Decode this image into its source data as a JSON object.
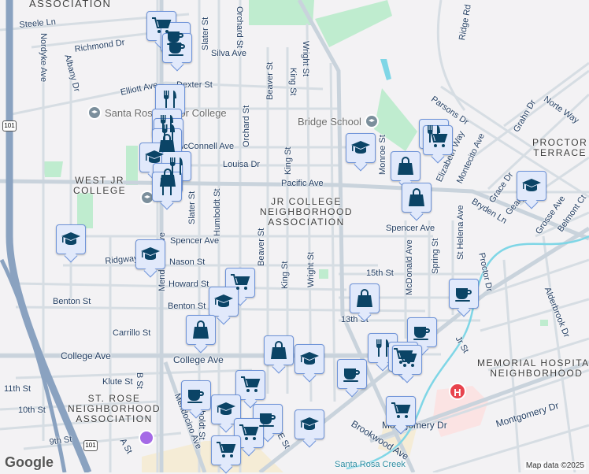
{
  "areas": {
    "association_top": "ASSOCIATION",
    "west_jr": "WEST JR\nCOLLEGE",
    "jr_college": "JR COLLEGE\nNEIGHBORHOOD\nASSOCIATION",
    "proctor": "PROCTOR\nTERRACE",
    "st_rose": "ST. ROSE\nNEIGHBORHOOD\nASSOCIATION",
    "memorial": "MEMORIAL HOSPITAL\nNEIGHBORHOOD"
  },
  "pois": {
    "srjc": "Santa Rosa Junior College",
    "bridge": "Bridge School"
  },
  "streets": [
    "Steele Ln",
    "Richmond Dr",
    "Nordyke Ave",
    "Albany Dr",
    "Slater St",
    "Orchard St",
    "Silva Ave",
    "Elliott Ave",
    "Dexter St",
    "Beaver St",
    "King St",
    "Orchard St",
    "McConnell Ave",
    "Louisa Dr",
    "King St",
    "Pacific Ave",
    "Slater St",
    "Humboldt St",
    "Mendocino Ave",
    "Spencer Ave",
    "Beaver St",
    "Wright St",
    "Ridgway Ave",
    "Nason St",
    "Howard St",
    "King St",
    "Benton St",
    "Benton St",
    "Carrillo St",
    "College Ave",
    "College Ave",
    "Klute St",
    "B St",
    "11th St",
    "10th St",
    "9th St",
    "A St",
    "Mendocino Ave",
    "Monroe St",
    "Wright St",
    "Ridge Rd",
    "Parsons Dr",
    "Norte Way",
    "Grahn Dr",
    "Elizabeth Way",
    "Montecito Ave",
    "Grace Dr",
    "Geary",
    "Grosse Ave",
    "Belmont Ct",
    "Bryden Ln",
    "Spencer Ave",
    "St Helena Ave",
    "Spring St",
    "McDonald Ave",
    "15th St",
    "Proctor Dr",
    "13th St",
    "Jr St",
    "Alderbrook Dr",
    "Montgomery Dr",
    "Montgomery Dr",
    "Brookwood Ave",
    "Santa Rosa Creek",
    "E St",
    "Humboldt St"
  ],
  "hospital_label": "H",
  "highway_shield": "101",
  "attribution": "Map data ©2025",
  "logo": "Google",
  "colors": {
    "marker_bg": "#e1e9fb",
    "marker_border": "#6e93d8",
    "icon": "#0b4466",
    "park": "#bfeccf",
    "water": "#7fd6e6",
    "hospital": "#e8434d"
  }
}
